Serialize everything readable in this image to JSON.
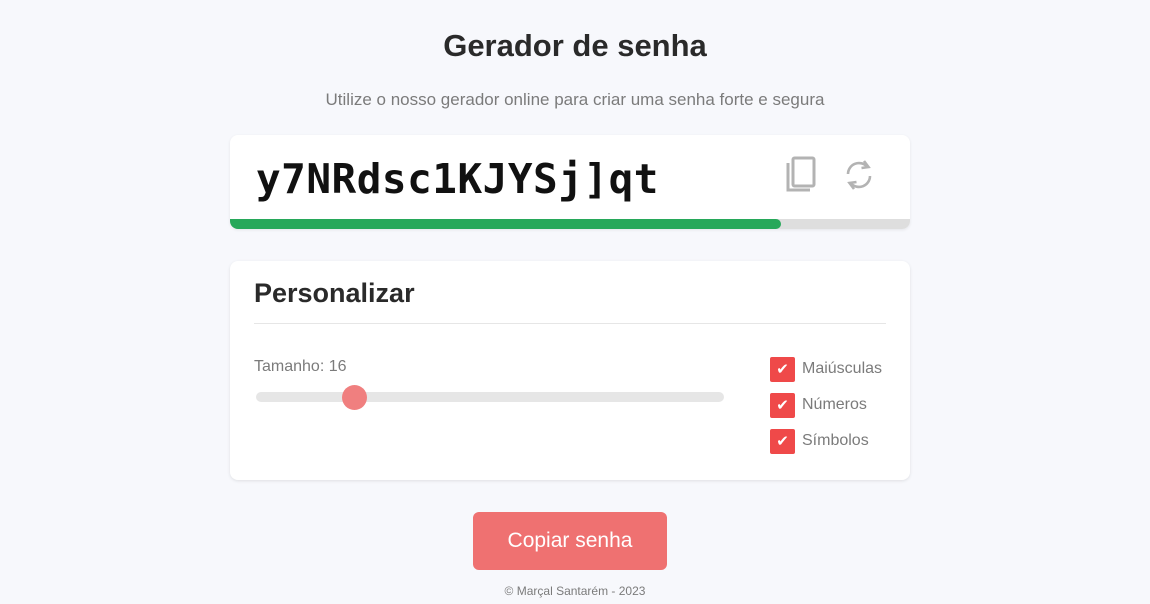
{
  "header": {
    "title": "Gerador de senha",
    "subtitle": "Utilize o nosso gerador online para criar uma senha forte e segura"
  },
  "password": {
    "value": "y7NRdsc1KJYSj]qt",
    "copy_icon": "copy-icon",
    "refresh_icon": "refresh-icon",
    "strength_fraction": 0.81,
    "strength_color": "#27a85a"
  },
  "customize": {
    "title": "Personalizar",
    "length_label": "Tamanho: 16",
    "length_value": 16,
    "slider_fraction": 0.21,
    "options": [
      {
        "label": "Maiúsculas",
        "checked": true
      },
      {
        "label": "Números",
        "checked": true
      },
      {
        "label": "Símbolos",
        "checked": true
      }
    ],
    "check_glyph": "✔"
  },
  "actions": {
    "copy_button_label": "Copiar senha"
  },
  "footer": {
    "text": "© Marçal Santarém - 2023"
  },
  "colors": {
    "accent": "#ef4949",
    "button": "#ef7171",
    "background": "#f7f8fc"
  }
}
